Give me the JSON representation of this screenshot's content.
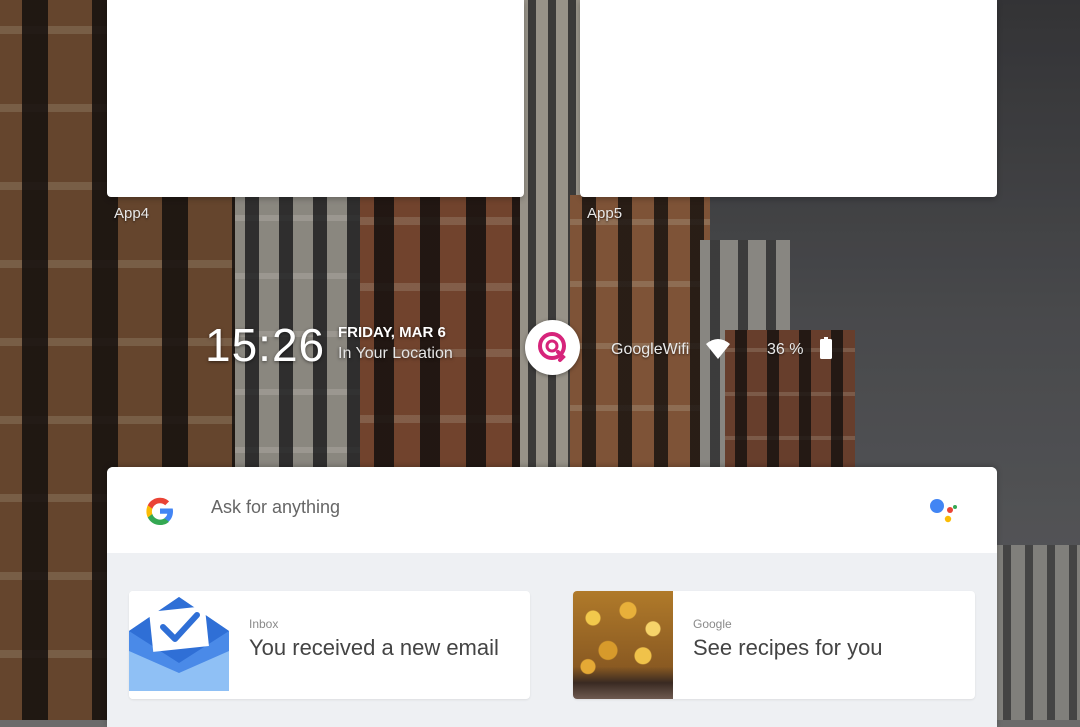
{
  "recents": {
    "apps": [
      {
        "label": "App4"
      },
      {
        "label": "App5"
      }
    ]
  },
  "status": {
    "time": "15:26",
    "date": "FRIDAY, MAR 6",
    "location": "In Your Location",
    "wifi_name": "GoogleWifi",
    "battery": "36 %",
    "center_logo_icon": "assistant-logo-icon"
  },
  "search": {
    "placeholder": "Ask for anything",
    "value": "",
    "left_icon": "google-g-icon",
    "right_icon": "google-assistant-icon"
  },
  "cards": [
    {
      "source": "Inbox",
      "title": "You received a new email",
      "icon": "inbox-envelope-icon"
    },
    {
      "source": "Google",
      "title": "See recipes for you",
      "icon": "food-photo"
    }
  ],
  "colors": {
    "google_blue": "#4285F4",
    "google_red": "#EA4335",
    "google_yellow": "#FBBC05",
    "google_green": "#34A853",
    "logo_magenta": "#d6247b"
  }
}
